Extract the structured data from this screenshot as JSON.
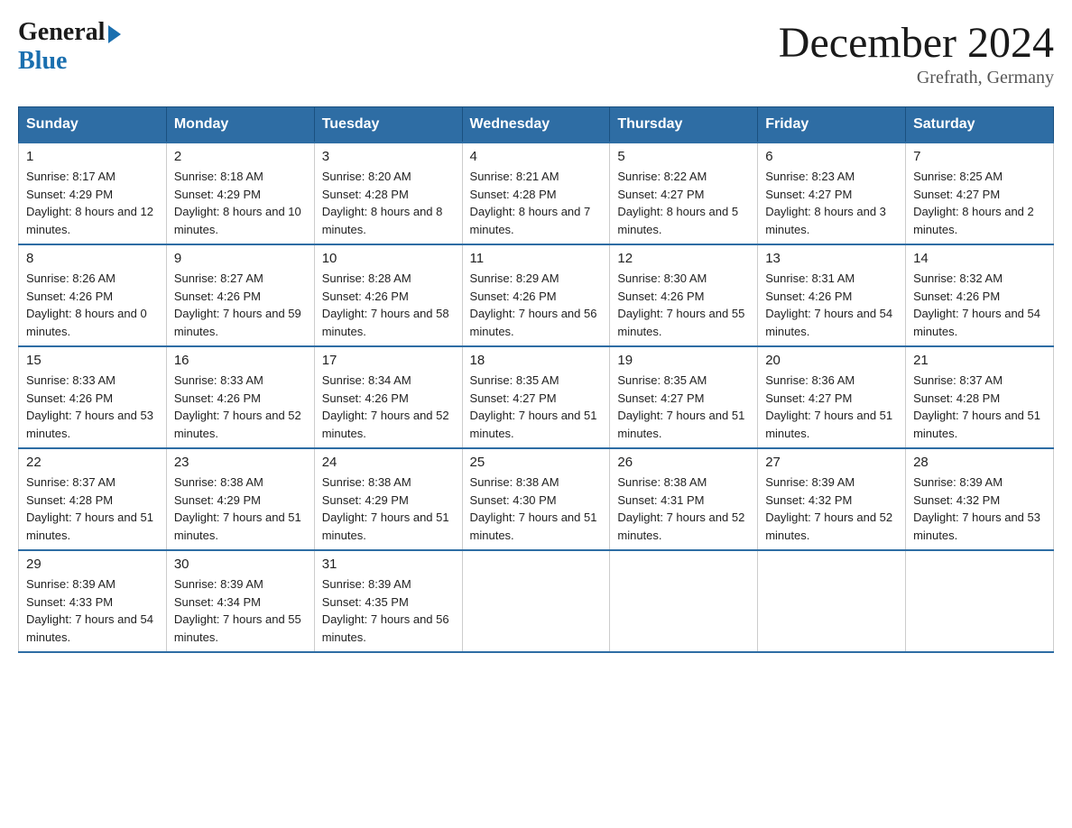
{
  "header": {
    "logo_general": "General",
    "logo_blue": "Blue",
    "month_year": "December 2024",
    "location": "Grefrath, Germany"
  },
  "days_of_week": [
    "Sunday",
    "Monday",
    "Tuesday",
    "Wednesday",
    "Thursday",
    "Friday",
    "Saturday"
  ],
  "weeks": [
    [
      {
        "day": "1",
        "sunrise": "8:17 AM",
        "sunset": "4:29 PM",
        "daylight": "8 hours and 12 minutes."
      },
      {
        "day": "2",
        "sunrise": "8:18 AM",
        "sunset": "4:29 PM",
        "daylight": "8 hours and 10 minutes."
      },
      {
        "day": "3",
        "sunrise": "8:20 AM",
        "sunset": "4:28 PM",
        "daylight": "8 hours and 8 minutes."
      },
      {
        "day": "4",
        "sunrise": "8:21 AM",
        "sunset": "4:28 PM",
        "daylight": "8 hours and 7 minutes."
      },
      {
        "day": "5",
        "sunrise": "8:22 AM",
        "sunset": "4:27 PM",
        "daylight": "8 hours and 5 minutes."
      },
      {
        "day": "6",
        "sunrise": "8:23 AM",
        "sunset": "4:27 PM",
        "daylight": "8 hours and 3 minutes."
      },
      {
        "day": "7",
        "sunrise": "8:25 AM",
        "sunset": "4:27 PM",
        "daylight": "8 hours and 2 minutes."
      }
    ],
    [
      {
        "day": "8",
        "sunrise": "8:26 AM",
        "sunset": "4:26 PM",
        "daylight": "8 hours and 0 minutes."
      },
      {
        "day": "9",
        "sunrise": "8:27 AM",
        "sunset": "4:26 PM",
        "daylight": "7 hours and 59 minutes."
      },
      {
        "day": "10",
        "sunrise": "8:28 AM",
        "sunset": "4:26 PM",
        "daylight": "7 hours and 58 minutes."
      },
      {
        "day": "11",
        "sunrise": "8:29 AM",
        "sunset": "4:26 PM",
        "daylight": "7 hours and 56 minutes."
      },
      {
        "day": "12",
        "sunrise": "8:30 AM",
        "sunset": "4:26 PM",
        "daylight": "7 hours and 55 minutes."
      },
      {
        "day": "13",
        "sunrise": "8:31 AM",
        "sunset": "4:26 PM",
        "daylight": "7 hours and 54 minutes."
      },
      {
        "day": "14",
        "sunrise": "8:32 AM",
        "sunset": "4:26 PM",
        "daylight": "7 hours and 54 minutes."
      }
    ],
    [
      {
        "day": "15",
        "sunrise": "8:33 AM",
        "sunset": "4:26 PM",
        "daylight": "7 hours and 53 minutes."
      },
      {
        "day": "16",
        "sunrise": "8:33 AM",
        "sunset": "4:26 PM",
        "daylight": "7 hours and 52 minutes."
      },
      {
        "day": "17",
        "sunrise": "8:34 AM",
        "sunset": "4:26 PM",
        "daylight": "7 hours and 52 minutes."
      },
      {
        "day": "18",
        "sunrise": "8:35 AM",
        "sunset": "4:27 PM",
        "daylight": "7 hours and 51 minutes."
      },
      {
        "day": "19",
        "sunrise": "8:35 AM",
        "sunset": "4:27 PM",
        "daylight": "7 hours and 51 minutes."
      },
      {
        "day": "20",
        "sunrise": "8:36 AM",
        "sunset": "4:27 PM",
        "daylight": "7 hours and 51 minutes."
      },
      {
        "day": "21",
        "sunrise": "8:37 AM",
        "sunset": "4:28 PM",
        "daylight": "7 hours and 51 minutes."
      }
    ],
    [
      {
        "day": "22",
        "sunrise": "8:37 AM",
        "sunset": "4:28 PM",
        "daylight": "7 hours and 51 minutes."
      },
      {
        "day": "23",
        "sunrise": "8:38 AM",
        "sunset": "4:29 PM",
        "daylight": "7 hours and 51 minutes."
      },
      {
        "day": "24",
        "sunrise": "8:38 AM",
        "sunset": "4:29 PM",
        "daylight": "7 hours and 51 minutes."
      },
      {
        "day": "25",
        "sunrise": "8:38 AM",
        "sunset": "4:30 PM",
        "daylight": "7 hours and 51 minutes."
      },
      {
        "day": "26",
        "sunrise": "8:38 AM",
        "sunset": "4:31 PM",
        "daylight": "7 hours and 52 minutes."
      },
      {
        "day": "27",
        "sunrise": "8:39 AM",
        "sunset": "4:32 PM",
        "daylight": "7 hours and 52 minutes."
      },
      {
        "day": "28",
        "sunrise": "8:39 AM",
        "sunset": "4:32 PM",
        "daylight": "7 hours and 53 minutes."
      }
    ],
    [
      {
        "day": "29",
        "sunrise": "8:39 AM",
        "sunset": "4:33 PM",
        "daylight": "7 hours and 54 minutes."
      },
      {
        "day": "30",
        "sunrise": "8:39 AM",
        "sunset": "4:34 PM",
        "daylight": "7 hours and 55 minutes."
      },
      {
        "day": "31",
        "sunrise": "8:39 AM",
        "sunset": "4:35 PM",
        "daylight": "7 hours and 56 minutes."
      },
      null,
      null,
      null,
      null
    ]
  ],
  "labels": {
    "sunrise": "Sunrise:",
    "sunset": "Sunset:",
    "daylight": "Daylight:"
  }
}
